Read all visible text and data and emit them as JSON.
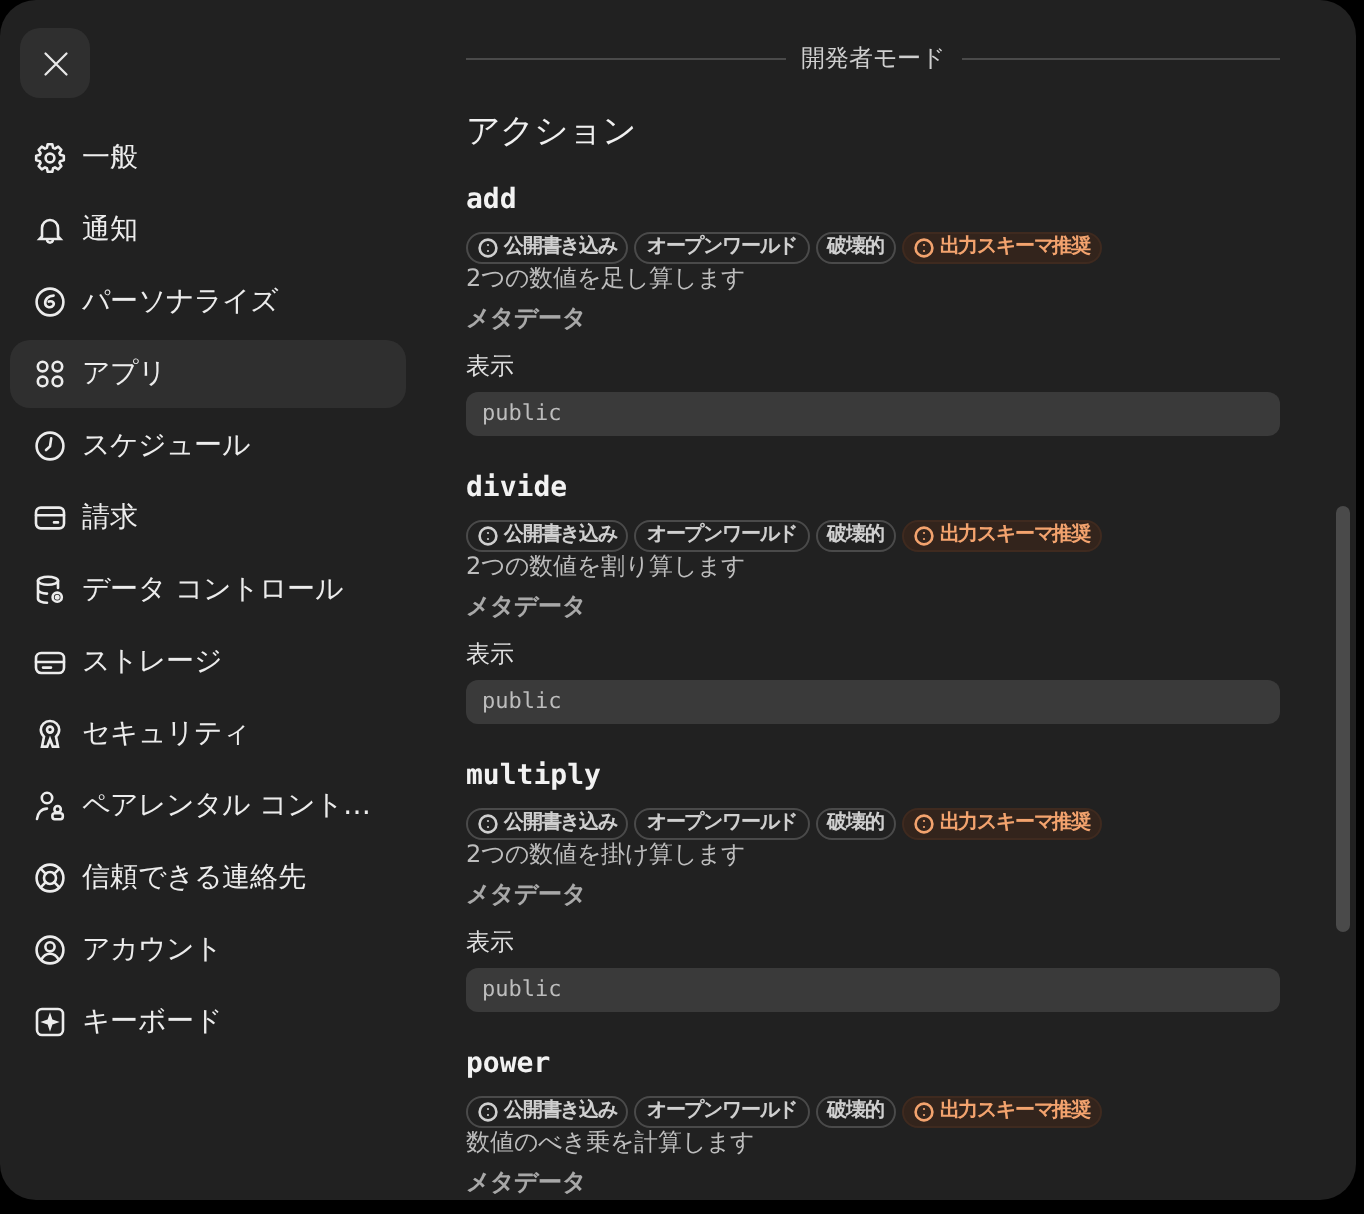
{
  "sidebar": {
    "items": [
      {
        "label": "一般",
        "selected": false
      },
      {
        "label": "通知",
        "selected": false
      },
      {
        "label": "パーソナライズ",
        "selected": false
      },
      {
        "label": "アプリ",
        "selected": true
      },
      {
        "label": "スケジュール",
        "selected": false
      },
      {
        "label": "請求",
        "selected": false
      },
      {
        "label": "データ コントロール",
        "selected": false
      },
      {
        "label": "ストレージ",
        "selected": false
      },
      {
        "label": "セキュリティ",
        "selected": false
      },
      {
        "label": "ペアレンタル コント…",
        "selected": false
      },
      {
        "label": "信頼できる連絡先",
        "selected": false
      },
      {
        "label": "アカウント",
        "selected": false
      },
      {
        "label": "キーボード",
        "selected": false
      }
    ]
  },
  "main": {
    "divider_label": "開発者モード",
    "heading": "アクション",
    "actions": [
      {
        "name": "add",
        "tags": [
          {
            "label": "公開書き込み",
            "kind": "info"
          },
          {
            "label": "オープンワールド",
            "kind": "plain"
          },
          {
            "label": "破壊的",
            "kind": "plain"
          },
          {
            "label": "出力スキーマ推奨",
            "kind": "warning"
          }
        ],
        "description": "2つの数値を足し算します",
        "metadata_label": "メタデータ",
        "visibility_label": "表示",
        "visibility_value": "public"
      },
      {
        "name": "divide",
        "tags": [
          {
            "label": "公開書き込み",
            "kind": "info"
          },
          {
            "label": "オープンワールド",
            "kind": "plain"
          },
          {
            "label": "破壊的",
            "kind": "plain"
          },
          {
            "label": "出力スキーマ推奨",
            "kind": "warning"
          }
        ],
        "description": "2つの数値を割り算します",
        "metadata_label": "メタデータ",
        "visibility_label": "表示",
        "visibility_value": "public"
      },
      {
        "name": "multiply",
        "tags": [
          {
            "label": "公開書き込み",
            "kind": "info"
          },
          {
            "label": "オープンワールド",
            "kind": "plain"
          },
          {
            "label": "破壊的",
            "kind": "plain"
          },
          {
            "label": "出力スキーマ推奨",
            "kind": "warning"
          }
        ],
        "description": "2つの数値を掛け算します",
        "metadata_label": "メタデータ",
        "visibility_label": "表示",
        "visibility_value": "public"
      },
      {
        "name": "power",
        "tags": [
          {
            "label": "公開書き込み",
            "kind": "info"
          },
          {
            "label": "オープンワールド",
            "kind": "plain"
          },
          {
            "label": "破壊的",
            "kind": "plain"
          },
          {
            "label": "出力スキーマ推奨",
            "kind": "warning"
          }
        ],
        "description": "数値のべき乗を計算します",
        "metadata_label": "メタデータ"
      }
    ]
  }
}
